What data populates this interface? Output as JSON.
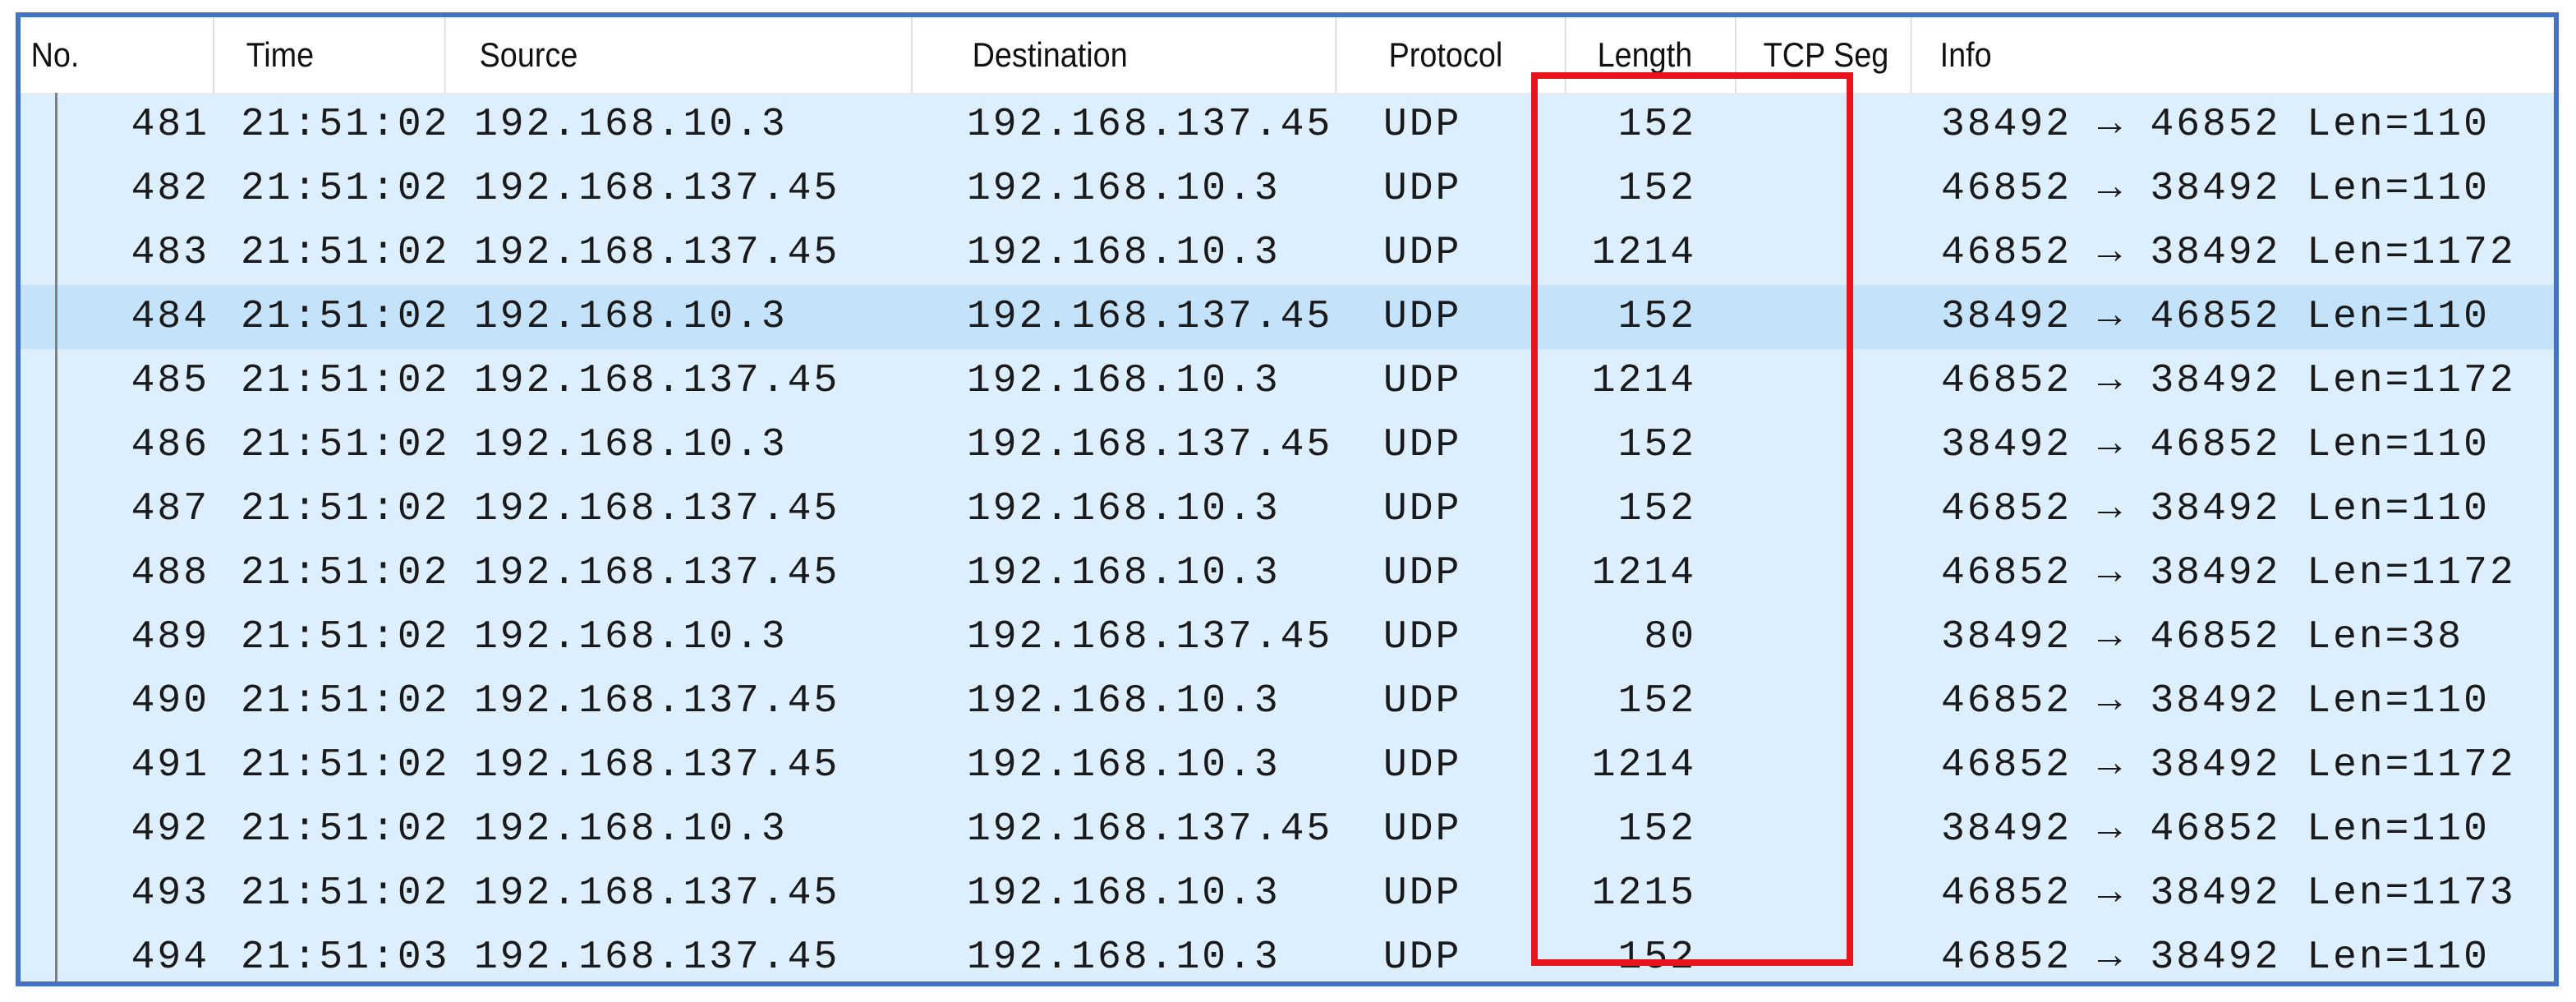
{
  "columns": [
    "No.",
    "Time",
    "Source",
    "Destination",
    "Protocol",
    "Length",
    "TCP Seg",
    "Info"
  ],
  "selected_row": "484",
  "highlight_color": "#e8141c",
  "rows": [
    {
      "no": "481",
      "time": "21:51:02",
      "src": "192.168.10.3",
      "dst": "192.168.137.45",
      "proto": "UDP",
      "len": "152",
      "info": "38492 → 46852 Len=110"
    },
    {
      "no": "482",
      "time": "21:51:02",
      "src": "192.168.137.45",
      "dst": "192.168.10.3",
      "proto": "UDP",
      "len": "152",
      "info": "46852 → 38492 Len=110"
    },
    {
      "no": "483",
      "time": "21:51:02",
      "src": "192.168.137.45",
      "dst": "192.168.10.3",
      "proto": "UDP",
      "len": "1214",
      "info": "46852 → 38492 Len=1172"
    },
    {
      "no": "484",
      "time": "21:51:02",
      "src": "192.168.10.3",
      "dst": "192.168.137.45",
      "proto": "UDP",
      "len": "152",
      "info": "38492 → 46852 Len=110"
    },
    {
      "no": "485",
      "time": "21:51:02",
      "src": "192.168.137.45",
      "dst": "192.168.10.3",
      "proto": "UDP",
      "len": "1214",
      "info": "46852 → 38492 Len=1172"
    },
    {
      "no": "486",
      "time": "21:51:02",
      "src": "192.168.10.3",
      "dst": "192.168.137.45",
      "proto": "UDP",
      "len": "152",
      "info": "38492 → 46852 Len=110"
    },
    {
      "no": "487",
      "time": "21:51:02",
      "src": "192.168.137.45",
      "dst": "192.168.10.3",
      "proto": "UDP",
      "len": "152",
      "info": "46852 → 38492 Len=110"
    },
    {
      "no": "488",
      "time": "21:51:02",
      "src": "192.168.137.45",
      "dst": "192.168.10.3",
      "proto": "UDP",
      "len": "1214",
      "info": "46852 → 38492 Len=1172"
    },
    {
      "no": "489",
      "time": "21:51:02",
      "src": "192.168.10.3",
      "dst": "192.168.137.45",
      "proto": "UDP",
      "len": "80",
      "info": "38492 → 46852 Len=38"
    },
    {
      "no": "490",
      "time": "21:51:02",
      "src": "192.168.137.45",
      "dst": "192.168.10.3",
      "proto": "UDP",
      "len": "152",
      "info": "46852 → 38492 Len=110"
    },
    {
      "no": "491",
      "time": "21:51:02",
      "src": "192.168.137.45",
      "dst": "192.168.10.3",
      "proto": "UDP",
      "len": "1214",
      "info": "46852 → 38492 Len=1172"
    },
    {
      "no": "492",
      "time": "21:51:02",
      "src": "192.168.10.3",
      "dst": "192.168.137.45",
      "proto": "UDP",
      "len": "152",
      "info": "38492 → 46852 Len=110"
    },
    {
      "no": "493",
      "time": "21:51:02",
      "src": "192.168.137.45",
      "dst": "192.168.10.3",
      "proto": "UDP",
      "len": "1215",
      "info": "46852 → 38492 Len=1173"
    },
    {
      "no": "494",
      "time": "21:51:03",
      "src": "192.168.137.45",
      "dst": "192.168.10.3",
      "proto": "UDP",
      "len": "152",
      "info": "46852 → 38492 Len=110"
    }
  ]
}
